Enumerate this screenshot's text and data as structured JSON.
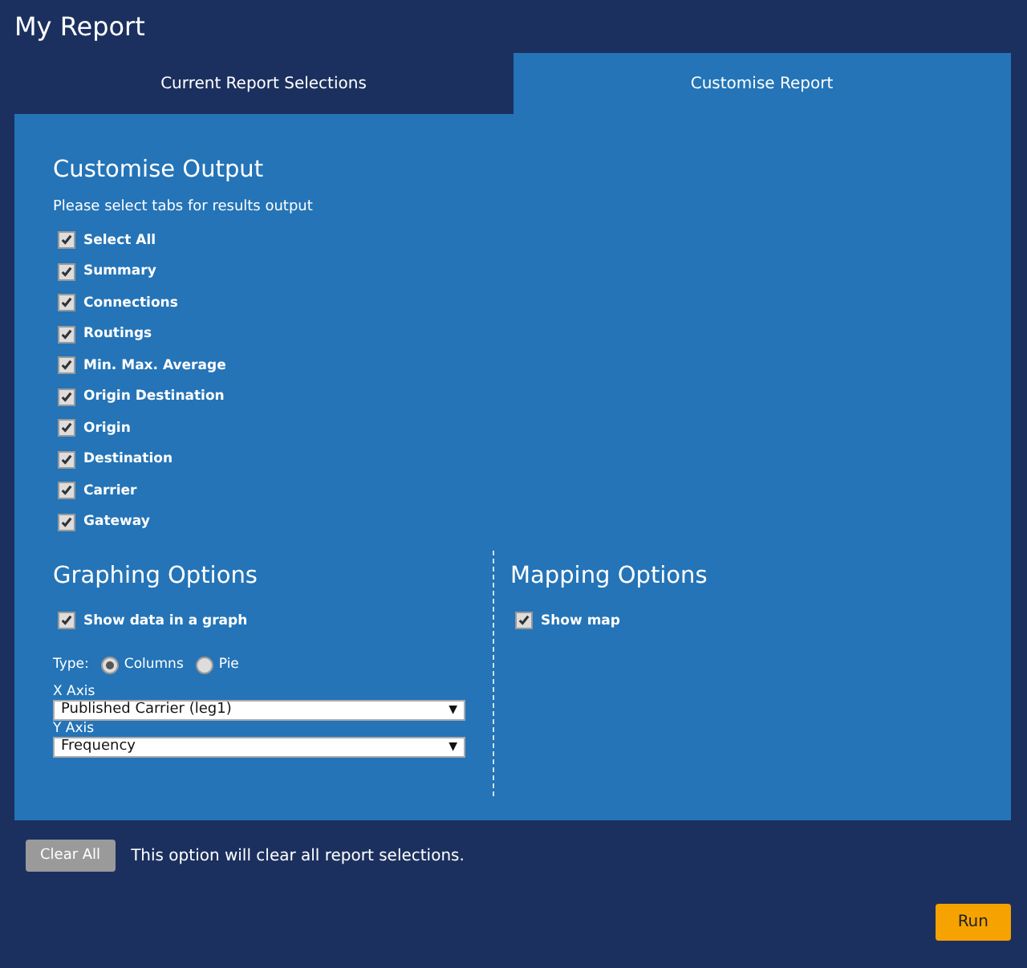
{
  "title": "My Report",
  "tabs": [
    {
      "label": "Current Report Selections",
      "selected": false
    },
    {
      "label": "Customise Report",
      "selected": true
    }
  ],
  "output": {
    "heading": "Customise Output",
    "instruction": "Please select tabs for results output",
    "options": [
      {
        "label": "Select All",
        "checked": true
      },
      {
        "label": "Summary",
        "checked": true
      },
      {
        "label": "Connections",
        "checked": true
      },
      {
        "label": "Routings",
        "checked": true
      },
      {
        "label": "Min. Max. Average",
        "checked": true
      },
      {
        "label": "Origin Destination",
        "checked": true
      },
      {
        "label": "Origin",
        "checked": true
      },
      {
        "label": "Destination",
        "checked": true
      },
      {
        "label": "Carrier",
        "checked": true
      },
      {
        "label": "Gateway",
        "checked": true
      }
    ]
  },
  "graphing": {
    "heading": "Graphing Options",
    "show": {
      "label": "Show data in a graph",
      "checked": true
    },
    "type_label": "Type:",
    "types": [
      {
        "label": "Columns",
        "selected": true
      },
      {
        "label": "Pie",
        "selected": false
      }
    ],
    "x_axis": {
      "label": "X Axis",
      "value": "Published Carrier (leg1)",
      "arrow": "▼"
    },
    "y_axis": {
      "label": "Y Axis",
      "value": "Frequency",
      "arrow": "▼"
    }
  },
  "mapping": {
    "heading": "Mapping Options",
    "show": {
      "label": "Show map",
      "checked": true
    }
  },
  "clear": {
    "button": "Clear All",
    "note": "This option will clear all report selections."
  },
  "run": "Run"
}
